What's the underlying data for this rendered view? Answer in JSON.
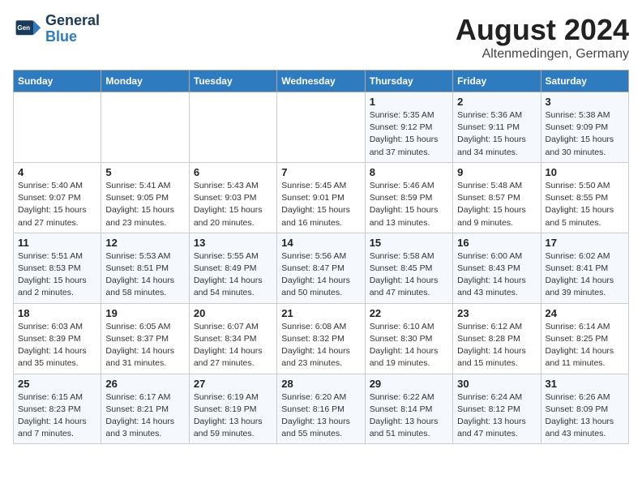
{
  "header": {
    "logo_line1": "General",
    "logo_line2": "Blue",
    "main_title": "August 2024",
    "subtitle": "Altenmedingen, Germany"
  },
  "days_of_week": [
    "Sunday",
    "Monday",
    "Tuesday",
    "Wednesday",
    "Thursday",
    "Friday",
    "Saturday"
  ],
  "weeks": [
    [
      {
        "day": "",
        "info": ""
      },
      {
        "day": "",
        "info": ""
      },
      {
        "day": "",
        "info": ""
      },
      {
        "day": "",
        "info": ""
      },
      {
        "day": "1",
        "info": "Sunrise: 5:35 AM\nSunset: 9:12 PM\nDaylight: 15 hours\nand 37 minutes."
      },
      {
        "day": "2",
        "info": "Sunrise: 5:36 AM\nSunset: 9:11 PM\nDaylight: 15 hours\nand 34 minutes."
      },
      {
        "day": "3",
        "info": "Sunrise: 5:38 AM\nSunset: 9:09 PM\nDaylight: 15 hours\nand 30 minutes."
      }
    ],
    [
      {
        "day": "4",
        "info": "Sunrise: 5:40 AM\nSunset: 9:07 PM\nDaylight: 15 hours\nand 27 minutes."
      },
      {
        "day": "5",
        "info": "Sunrise: 5:41 AM\nSunset: 9:05 PM\nDaylight: 15 hours\nand 23 minutes."
      },
      {
        "day": "6",
        "info": "Sunrise: 5:43 AM\nSunset: 9:03 PM\nDaylight: 15 hours\nand 20 minutes."
      },
      {
        "day": "7",
        "info": "Sunrise: 5:45 AM\nSunset: 9:01 PM\nDaylight: 15 hours\nand 16 minutes."
      },
      {
        "day": "8",
        "info": "Sunrise: 5:46 AM\nSunset: 8:59 PM\nDaylight: 15 hours\nand 13 minutes."
      },
      {
        "day": "9",
        "info": "Sunrise: 5:48 AM\nSunset: 8:57 PM\nDaylight: 15 hours\nand 9 minutes."
      },
      {
        "day": "10",
        "info": "Sunrise: 5:50 AM\nSunset: 8:55 PM\nDaylight: 15 hours\nand 5 minutes."
      }
    ],
    [
      {
        "day": "11",
        "info": "Sunrise: 5:51 AM\nSunset: 8:53 PM\nDaylight: 15 hours\nand 2 minutes."
      },
      {
        "day": "12",
        "info": "Sunrise: 5:53 AM\nSunset: 8:51 PM\nDaylight: 14 hours\nand 58 minutes."
      },
      {
        "day": "13",
        "info": "Sunrise: 5:55 AM\nSunset: 8:49 PM\nDaylight: 14 hours\nand 54 minutes."
      },
      {
        "day": "14",
        "info": "Sunrise: 5:56 AM\nSunset: 8:47 PM\nDaylight: 14 hours\nand 50 minutes."
      },
      {
        "day": "15",
        "info": "Sunrise: 5:58 AM\nSunset: 8:45 PM\nDaylight: 14 hours\nand 47 minutes."
      },
      {
        "day": "16",
        "info": "Sunrise: 6:00 AM\nSunset: 8:43 PM\nDaylight: 14 hours\nand 43 minutes."
      },
      {
        "day": "17",
        "info": "Sunrise: 6:02 AM\nSunset: 8:41 PM\nDaylight: 14 hours\nand 39 minutes."
      }
    ],
    [
      {
        "day": "18",
        "info": "Sunrise: 6:03 AM\nSunset: 8:39 PM\nDaylight: 14 hours\nand 35 minutes."
      },
      {
        "day": "19",
        "info": "Sunrise: 6:05 AM\nSunset: 8:37 PM\nDaylight: 14 hours\nand 31 minutes."
      },
      {
        "day": "20",
        "info": "Sunrise: 6:07 AM\nSunset: 8:34 PM\nDaylight: 14 hours\nand 27 minutes."
      },
      {
        "day": "21",
        "info": "Sunrise: 6:08 AM\nSunset: 8:32 PM\nDaylight: 14 hours\nand 23 minutes."
      },
      {
        "day": "22",
        "info": "Sunrise: 6:10 AM\nSunset: 8:30 PM\nDaylight: 14 hours\nand 19 minutes."
      },
      {
        "day": "23",
        "info": "Sunrise: 6:12 AM\nSunset: 8:28 PM\nDaylight: 14 hours\nand 15 minutes."
      },
      {
        "day": "24",
        "info": "Sunrise: 6:14 AM\nSunset: 8:25 PM\nDaylight: 14 hours\nand 11 minutes."
      }
    ],
    [
      {
        "day": "25",
        "info": "Sunrise: 6:15 AM\nSunset: 8:23 PM\nDaylight: 14 hours\nand 7 minutes."
      },
      {
        "day": "26",
        "info": "Sunrise: 6:17 AM\nSunset: 8:21 PM\nDaylight: 14 hours\nand 3 minutes."
      },
      {
        "day": "27",
        "info": "Sunrise: 6:19 AM\nSunset: 8:19 PM\nDaylight: 13 hours\nand 59 minutes."
      },
      {
        "day": "28",
        "info": "Sunrise: 6:20 AM\nSunset: 8:16 PM\nDaylight: 13 hours\nand 55 minutes."
      },
      {
        "day": "29",
        "info": "Sunrise: 6:22 AM\nSunset: 8:14 PM\nDaylight: 13 hours\nand 51 minutes."
      },
      {
        "day": "30",
        "info": "Sunrise: 6:24 AM\nSunset: 8:12 PM\nDaylight: 13 hours\nand 47 minutes."
      },
      {
        "day": "31",
        "info": "Sunrise: 6:26 AM\nSunset: 8:09 PM\nDaylight: 13 hours\nand 43 minutes."
      }
    ]
  ]
}
